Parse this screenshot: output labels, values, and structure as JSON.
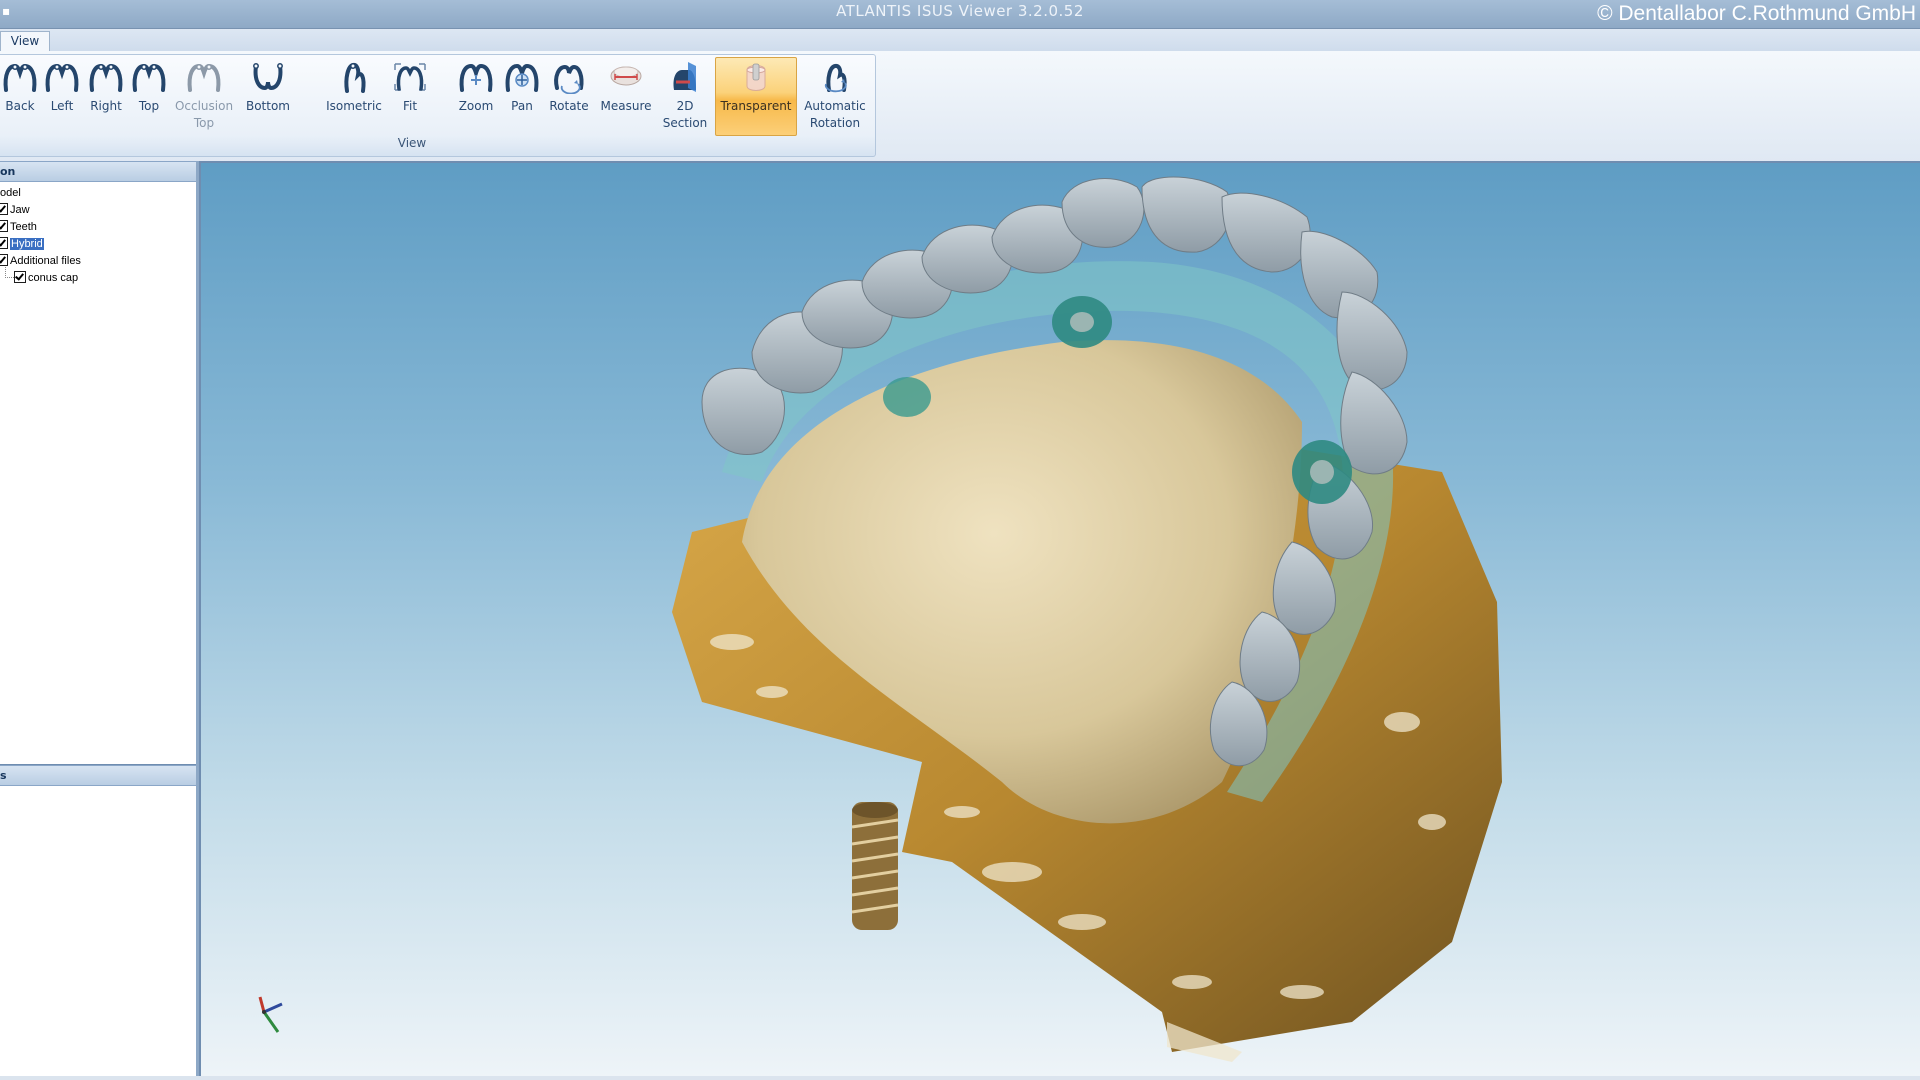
{
  "window": {
    "title": "ATLANTIS ISUS Viewer 3.2.0.52",
    "copyright": "©  Dentallabor C.Rothmund GmbH"
  },
  "tabs": [
    {
      "label": "View"
    }
  ],
  "ribbon": {
    "group_label": "View",
    "buttons": [
      {
        "label": "Back",
        "icon": "jaw-back-icon"
      },
      {
        "label": "Left",
        "icon": "jaw-left-icon"
      },
      {
        "label": "Right",
        "icon": "jaw-right-icon"
      },
      {
        "label": "Top",
        "icon": "jaw-top-icon"
      },
      {
        "label": "Occlusion Top",
        "label_line1": "Occlusion",
        "label_line2": "Top",
        "icon": "occlusion-top-icon",
        "disabled": true
      },
      {
        "label": "Bottom",
        "icon": "jaw-bottom-icon"
      },
      {
        "label": "Isometric",
        "icon": "isometric-icon"
      },
      {
        "label": "Fit",
        "icon": "fit-icon"
      },
      {
        "label": "Zoom",
        "icon": "zoom-icon"
      },
      {
        "label": "Pan",
        "icon": "pan-icon"
      },
      {
        "label": "Rotate",
        "icon": "rotate-icon"
      },
      {
        "label": "Measure",
        "icon": "measure-icon"
      },
      {
        "label": "2D Section",
        "label_line1": "2D",
        "label_line2": "Section",
        "icon": "2d-section-icon"
      },
      {
        "label": "Transparent",
        "icon": "transparent-icon",
        "active": true
      },
      {
        "label": "Automatic Rotation",
        "label_line1": "Automatic",
        "label_line2": "Rotation",
        "icon": "automatic-rotation-icon"
      }
    ]
  },
  "left_panel": {
    "header_top": "on",
    "header_bottom": "s",
    "tree": [
      {
        "label": "odel",
        "checked": null
      },
      {
        "label": "Jaw",
        "checked": true
      },
      {
        "label": "Teeth",
        "checked": true
      },
      {
        "label": "Hybrid",
        "checked": true,
        "selected": true
      },
      {
        "label": "Additional files",
        "checked": true
      },
      {
        "label": "conus cap",
        "checked": true
      }
    ]
  },
  "viewport": {
    "content": "3d-dental-model",
    "axis_gizmo": "axis-triad-icon"
  },
  "colors": {
    "viewport_top": "#5f9dc4",
    "viewport_bottom": "#eef4f8",
    "active_button": "#fbd27a",
    "gypsum_base": "#c8963a"
  }
}
